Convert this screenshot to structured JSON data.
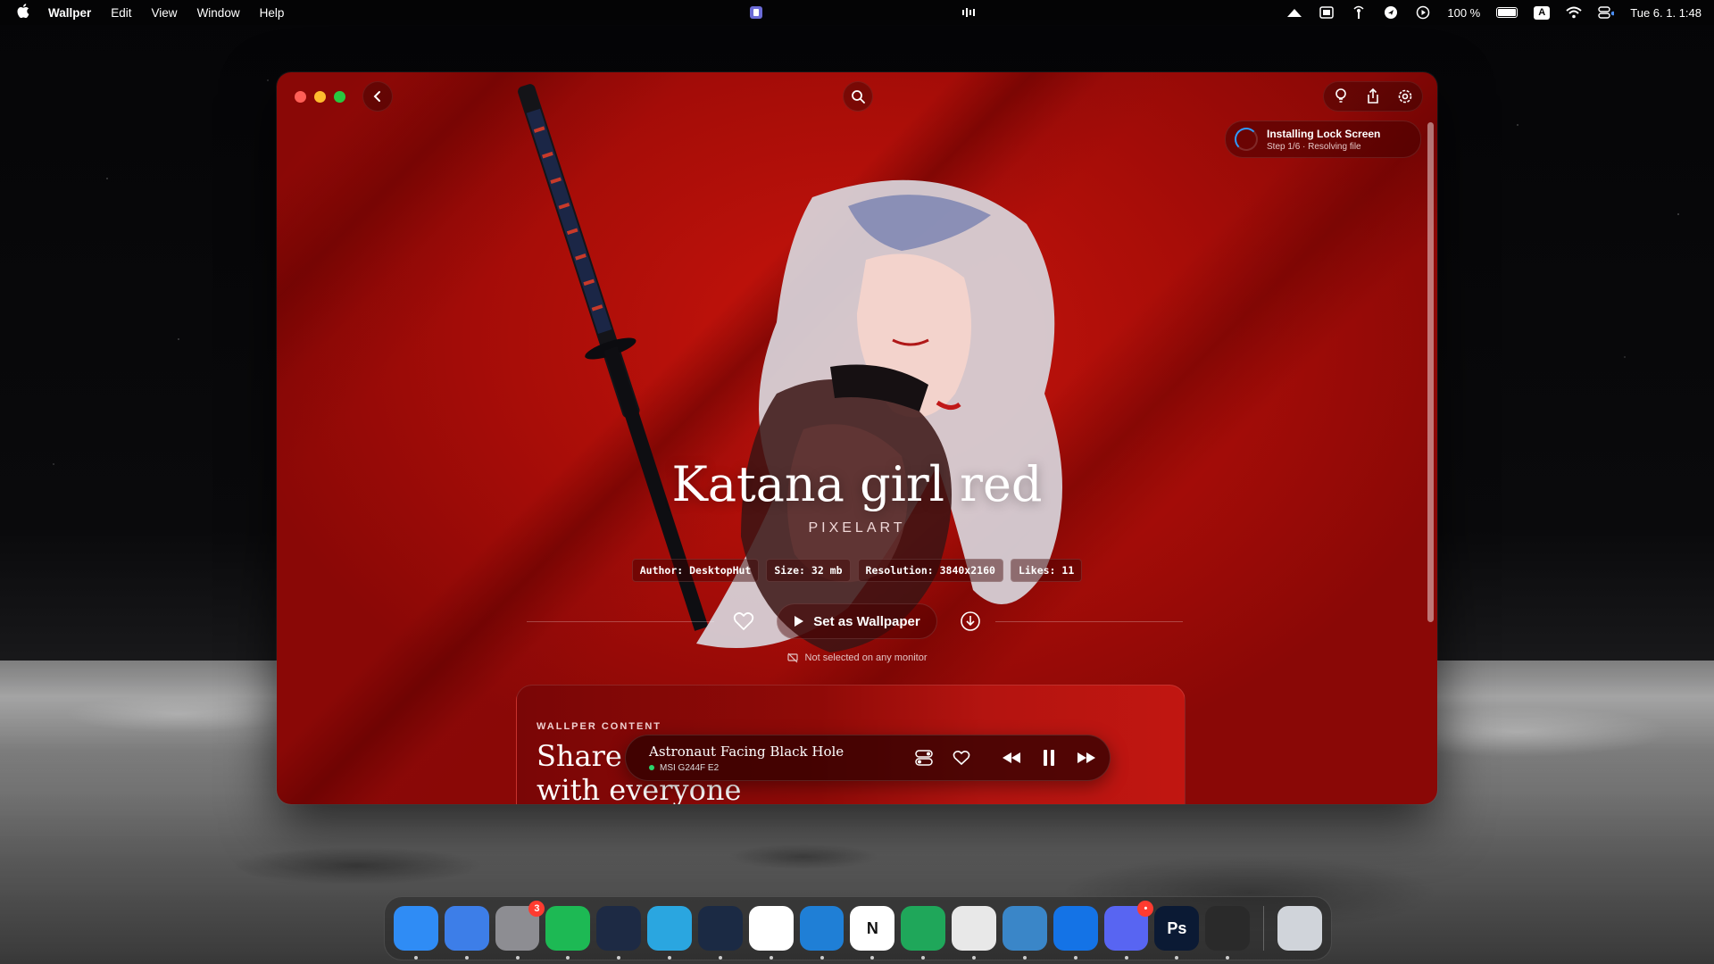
{
  "menubar": {
    "app_name": "Wallper",
    "menus": [
      "Edit",
      "View",
      "Window",
      "Help"
    ],
    "battery": "100 %",
    "keyboard_badge": "A",
    "clock": "Tue 6. 1.  1:48"
  },
  "window": {
    "toast": {
      "title": "Installing Lock Screen",
      "subtitle": "Step 1/6 · Resolving file"
    },
    "wallpaper": {
      "title": "Katana girl red",
      "category": "PIXELART",
      "meta": {
        "author": "Author: DesktopHut",
        "size": "Size: 32 mb",
        "resolution": "Resolution: 3840x2160",
        "likes": "Likes: 11"
      },
      "set_button": "Set as Wallpaper",
      "monitor_note": "Not selected on any monitor"
    },
    "content_card": {
      "kicker": "WALLPER CONTENT",
      "heading_line1": "Share",
      "heading_line2": "with everyone"
    },
    "player": {
      "title": "Astronaut Facing Black Hole",
      "monitor": "MSI G244F E2"
    }
  },
  "dock": {
    "apps": [
      {
        "name": "Finder",
        "color": "#2f8cf5",
        "glyph": ""
      },
      {
        "name": "Mail Client",
        "color": "#3d7ee8",
        "glyph": ""
      },
      {
        "name": "System Settings",
        "color": "#8d8d92",
        "glyph": "",
        "badge": "3"
      },
      {
        "name": "Spotify",
        "color": "#1db954",
        "glyph": ""
      },
      {
        "name": "Terminal App",
        "color": "#1d2a44",
        "glyph": ""
      },
      {
        "name": "Telegram",
        "color": "#2aa6e0",
        "glyph": ""
      },
      {
        "name": "Network Tool",
        "color": "#1b2a44",
        "glyph": ""
      },
      {
        "name": "Chrome",
        "color": "#ffffff",
        "glyph": ""
      },
      {
        "name": "VS Code",
        "color": "#1f7fd6",
        "glyph": ""
      },
      {
        "name": "Notion",
        "color": "#ffffff",
        "glyph": "N"
      },
      {
        "name": "Numbers",
        "color": "#1fa75a",
        "glyph": ""
      },
      {
        "name": "Sequel",
        "color": "#e8e8e8",
        "glyph": ""
      },
      {
        "name": "Database",
        "color": "#3a86c8",
        "glyph": ""
      },
      {
        "name": "Xcode",
        "color": "#1473e6",
        "glyph": ""
      },
      {
        "name": "Discord",
        "color": "#5865f2",
        "glyph": "",
        "badge": "•"
      },
      {
        "name": "Photoshop",
        "color": "#0b1a34",
        "glyph": "Ps"
      },
      {
        "name": "Mountain App",
        "color": "#2a2a2a",
        "glyph": ""
      },
      {
        "name": "Trash",
        "color": "#d0d4da",
        "glyph": ""
      }
    ]
  }
}
